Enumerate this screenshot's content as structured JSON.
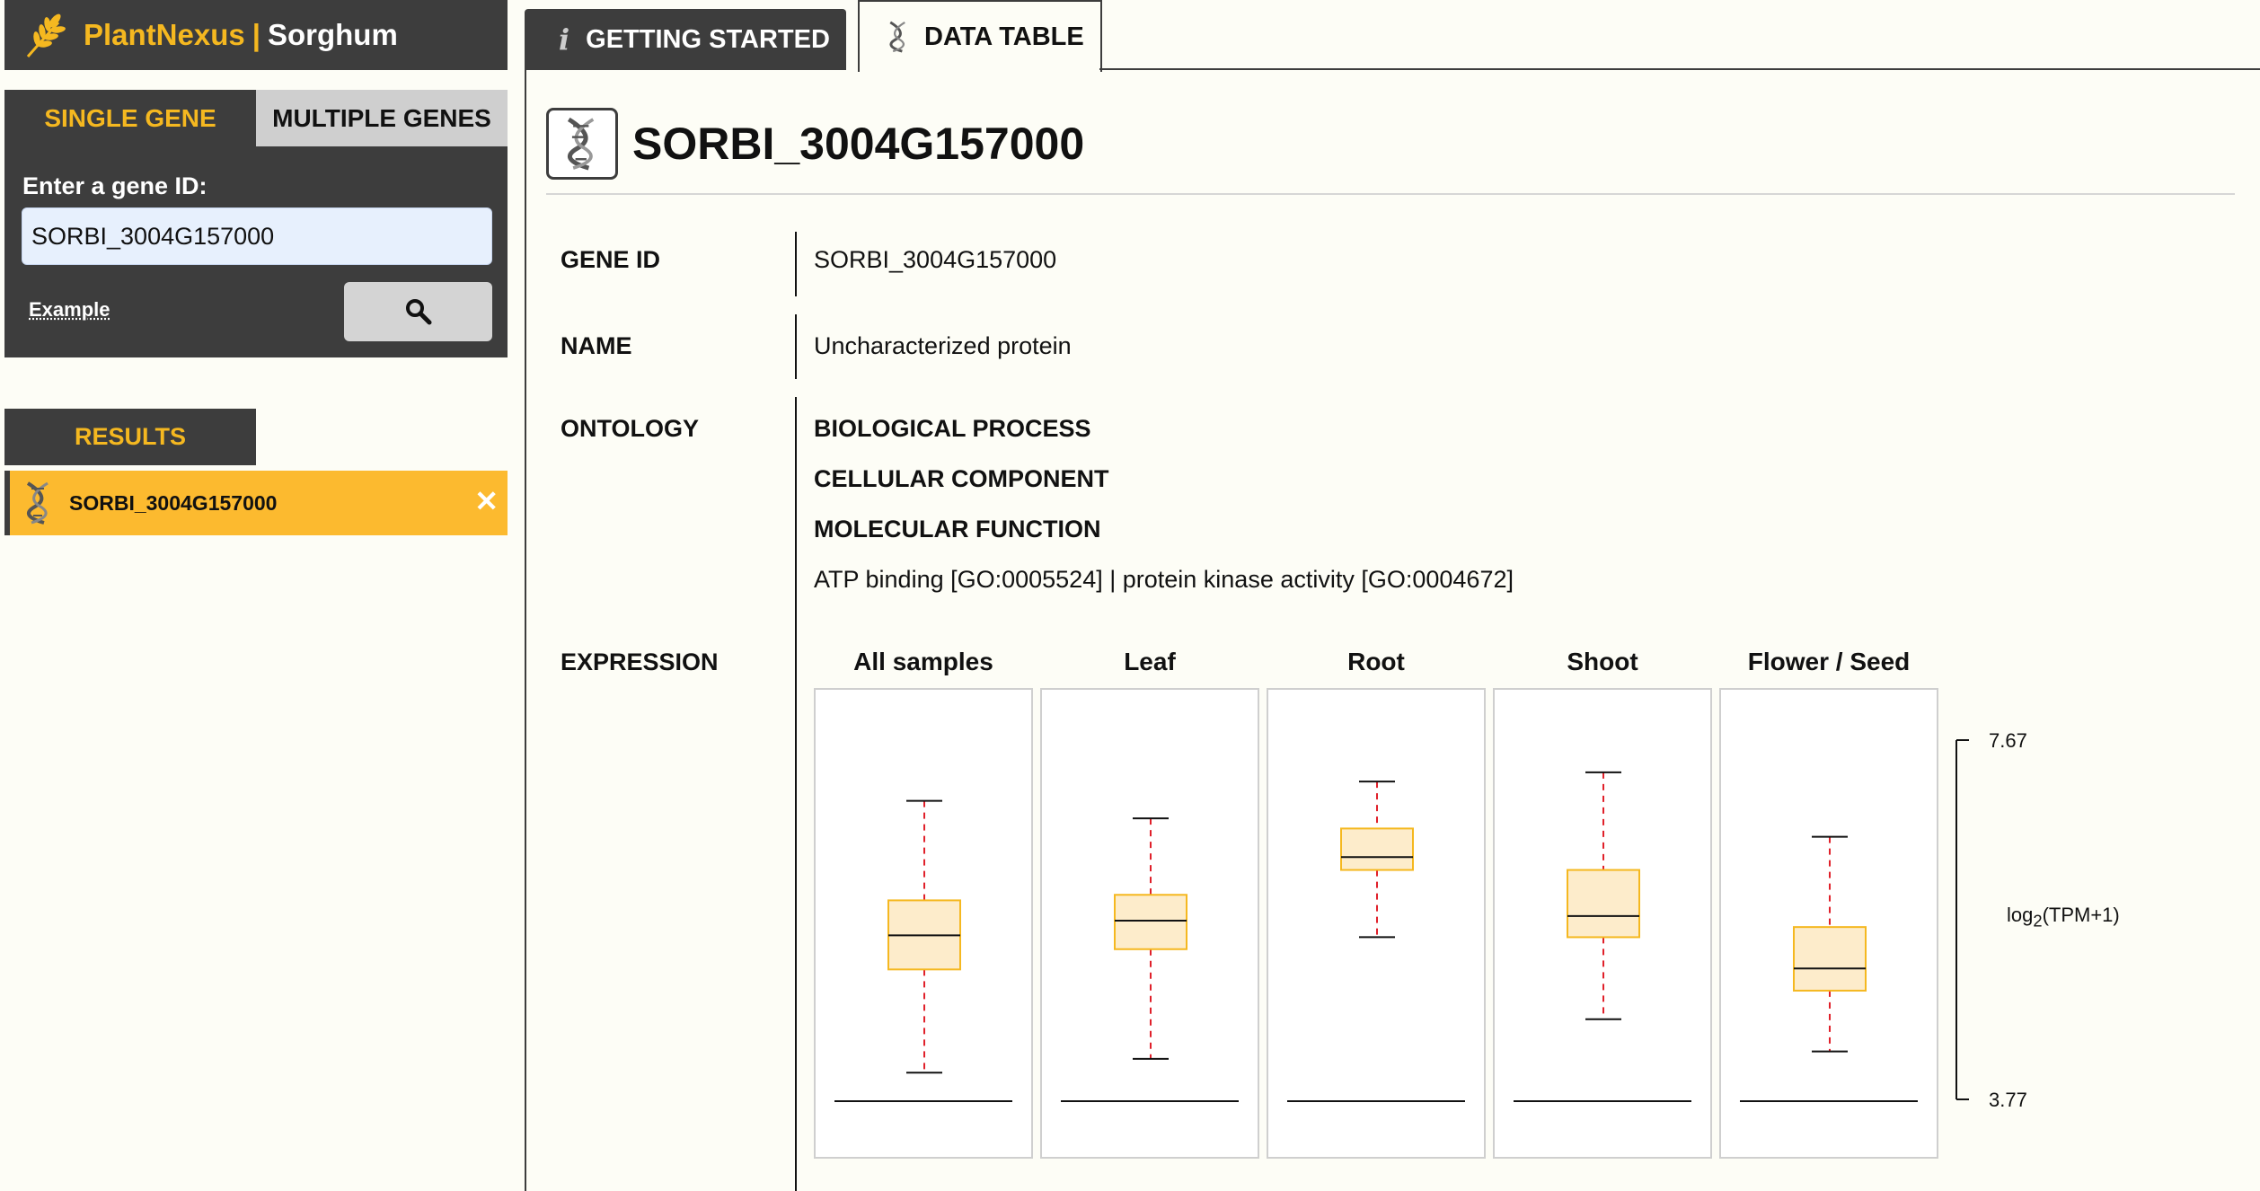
{
  "brand": {
    "name": "PlantNexus",
    "separator": "|",
    "species": "Sorghum"
  },
  "search": {
    "tabs": [
      "SINGLE GENE",
      "MULTIPLE GENES"
    ],
    "label": "Enter a gene ID:",
    "value": "SORBI_3004G157000",
    "example": "Example"
  },
  "results": {
    "header": "RESULTS",
    "items": [
      {
        "label": "SORBI_3004G157000",
        "close": "✕"
      }
    ]
  },
  "tabs": {
    "getting_started": "GETTING STARTED",
    "data_table": "DATA TABLE"
  },
  "gene": {
    "title": "SORBI_3004G157000",
    "rows": {
      "gene_id_label": "GENE ID",
      "gene_id_value": "SORBI_3004G157000",
      "name_label": "NAME",
      "name_value": "Uncharacterized protein",
      "ontology_label": "ONTOLOGY",
      "ontology_bp": "BIOLOGICAL PROCESS",
      "ontology_cc": "CELLULAR COMPONENT",
      "ontology_mf": "MOLECULAR FUNCTION",
      "ontology_mf_terms": "ATP binding [GO:0005524] | protein kinase activity [GO:0004672]",
      "expression_label": "EXPRESSION"
    }
  },
  "colors": {
    "dark": "#3d3d3d",
    "accent": "#f5b820",
    "box_fill": "#fdeccb",
    "box_stroke": "#f5b820",
    "whisker": "#e0202a"
  },
  "chart_data": {
    "type": "boxplot",
    "ylabel_base": "log",
    "ylabel_sub": "2",
    "ylabel_rest": "(TPM+1)",
    "ylim": [
      3.77,
      7.67
    ],
    "ymax_label": "7.67",
    "ymin_label": "3.77",
    "series": [
      {
        "name": "All samples",
        "min": 4.08,
        "q1": 5.2,
        "median": 5.57,
        "q3": 5.95,
        "max": 7.03
      },
      {
        "name": "Leaf",
        "min": 4.23,
        "q1": 5.42,
        "median": 5.73,
        "q3": 6.01,
        "max": 6.84
      },
      {
        "name": "Root",
        "min": 5.55,
        "q1": 6.28,
        "median": 6.42,
        "q3": 6.73,
        "max": 7.24
      },
      {
        "name": "Shoot",
        "min": 4.66,
        "q1": 5.55,
        "median": 5.78,
        "q3": 6.28,
        "max": 7.34
      },
      {
        "name": "Flower / Seed",
        "min": 4.31,
        "q1": 4.97,
        "median": 5.21,
        "q3": 5.66,
        "max": 6.64
      }
    ],
    "baseline": 3.77
  }
}
